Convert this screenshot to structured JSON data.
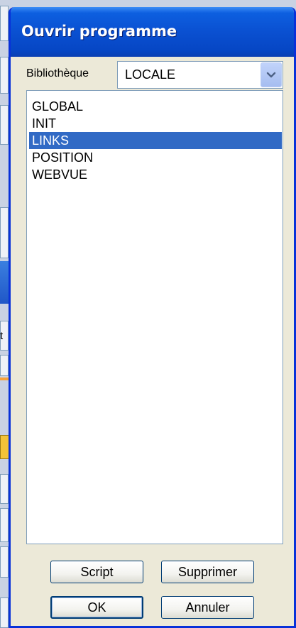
{
  "background": {
    "partial_letter": "t"
  },
  "dialog": {
    "title": "Ouvrir programme",
    "library_label": "Bibliothèque",
    "library_value": "LOCALE",
    "programs": [
      {
        "label": "GLOBAL",
        "selected": false
      },
      {
        "label": "INIT",
        "selected": false
      },
      {
        "label": "LINKS",
        "selected": true
      },
      {
        "label": "POSITION",
        "selected": false
      },
      {
        "label": "WEBVUE",
        "selected": false
      }
    ],
    "buttons": {
      "script": "Script",
      "delete": "Supprimer",
      "ok": "OK",
      "cancel": "Annuler"
    }
  },
  "colors": {
    "title_bar": "#0a50d1",
    "selection": "#316ac5",
    "dialog_face": "#ece9d8"
  },
  "icons": {
    "dropdown": "chevron-down-icon"
  }
}
